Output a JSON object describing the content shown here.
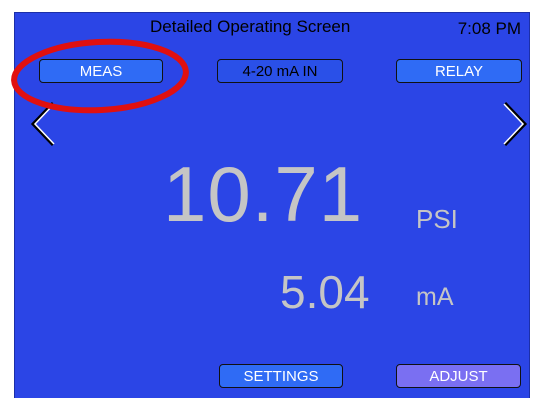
{
  "header": {
    "title": "Detailed Operating Screen",
    "time": "7:08 PM"
  },
  "tabs": [
    {
      "label": "MEAS",
      "selected": true
    },
    {
      "label": "4-20 mA IN",
      "selected": false
    },
    {
      "label": "RELAY",
      "selected": false
    }
  ],
  "navigation": {
    "prev_icon": "chevron-left-icon",
    "next_icon": "chevron-right-icon"
  },
  "reading": {
    "value": "10.71",
    "unit": "PSI"
  },
  "current": {
    "value": "5.04",
    "unit": "mA"
  },
  "footer": {
    "settings_label": "SETTINGS",
    "adjust_label": "ADJUST"
  },
  "colors": {
    "screen_background": "#2b45e6",
    "button": "#2f6bf5",
    "adjust_button": "#7a6ff2",
    "reading_text": "#c5c5c5",
    "highlight_ring": "#e01010"
  }
}
